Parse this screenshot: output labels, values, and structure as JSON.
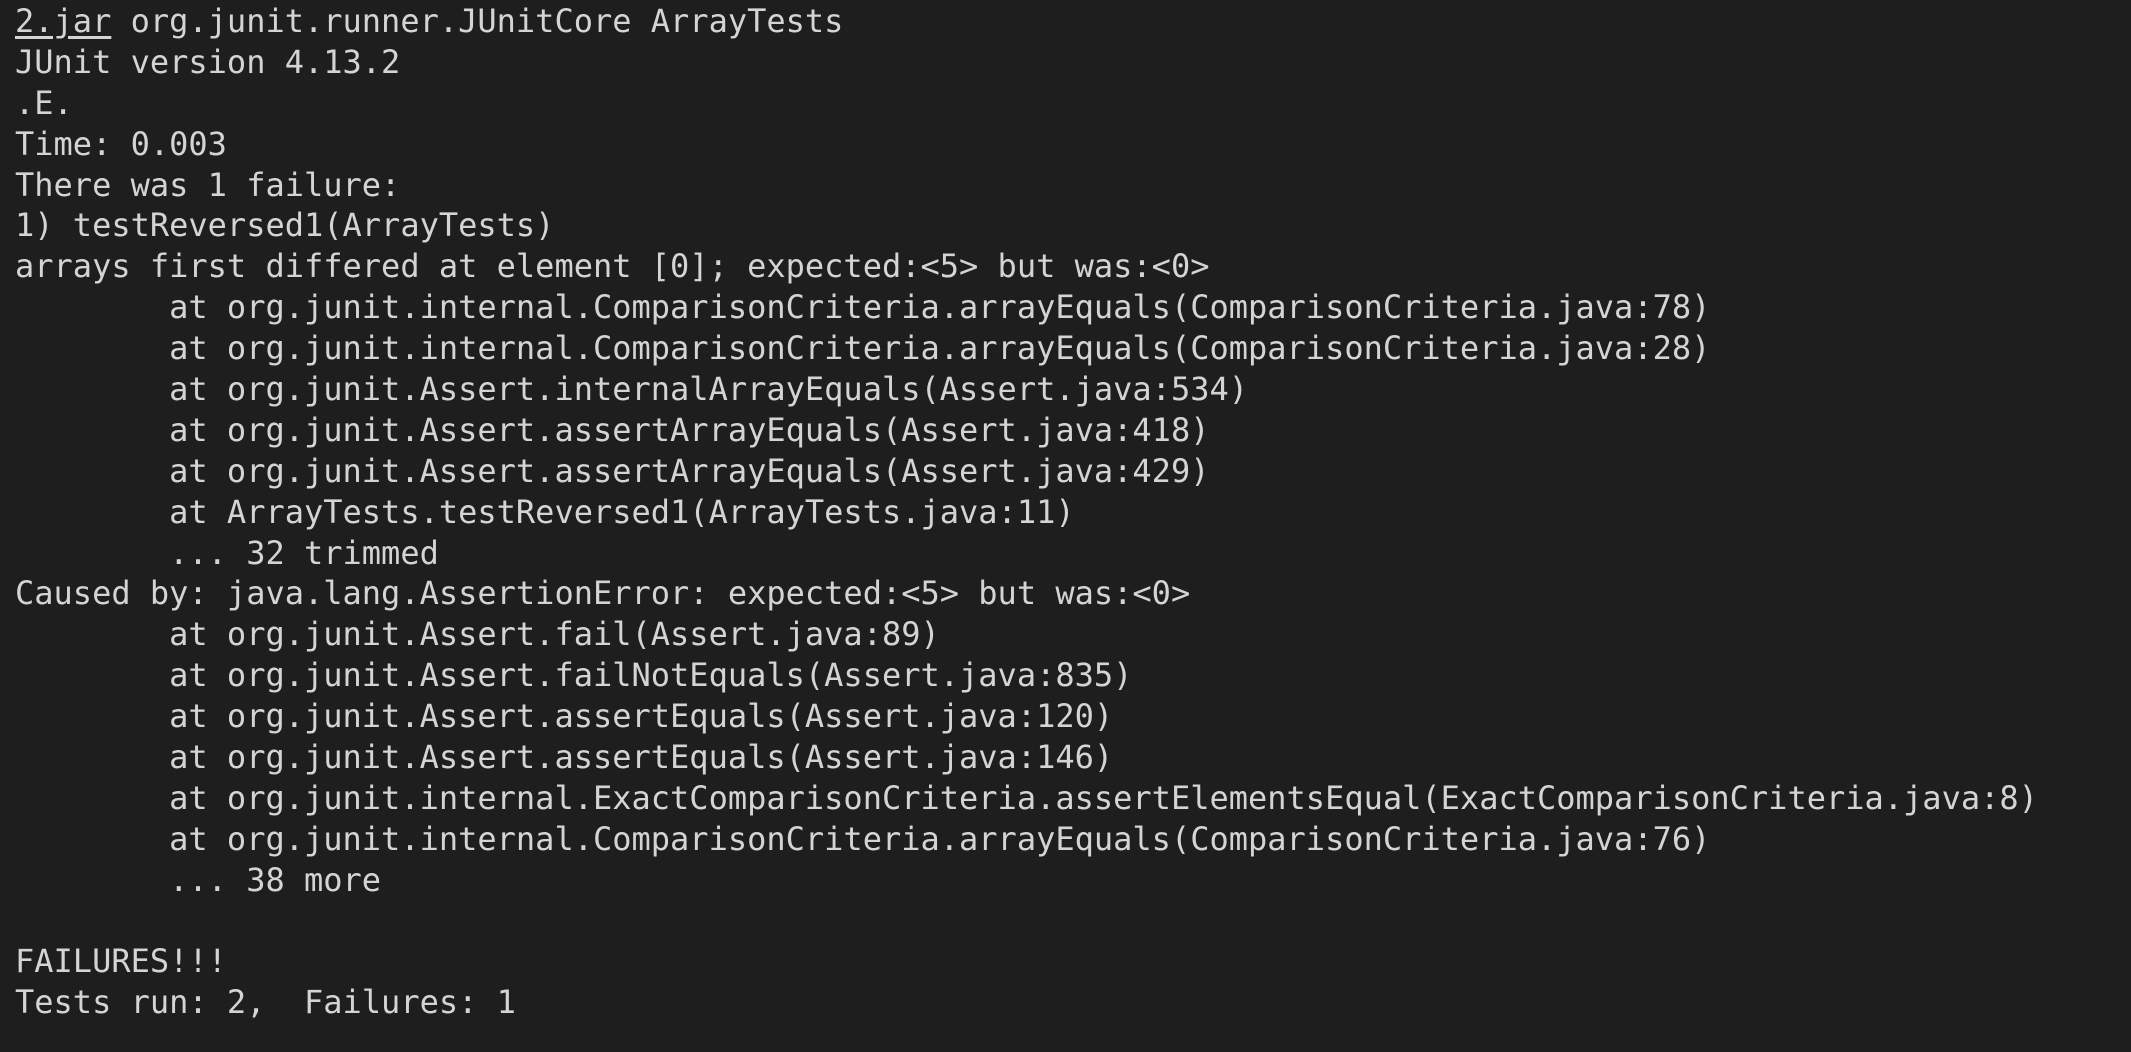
{
  "terminal": {
    "command": {
      "jar_prefix": "2.jar",
      "rest": " org.junit.runner.JUnitCore ArrayTests"
    },
    "lines": [
      "JUnit version 4.13.2",
      ".E.",
      "Time: 0.003",
      "There was 1 failure:",
      "1) testReversed1(ArrayTests)",
      "arrays first differed at element [0]; expected:<5> but was:<0>",
      "        at org.junit.internal.ComparisonCriteria.arrayEquals(ComparisonCriteria.java:78)",
      "        at org.junit.internal.ComparisonCriteria.arrayEquals(ComparisonCriteria.java:28)",
      "        at org.junit.Assert.internalArrayEquals(Assert.java:534)",
      "        at org.junit.Assert.assertArrayEquals(Assert.java:418)",
      "        at org.junit.Assert.assertArrayEquals(Assert.java:429)",
      "        at ArrayTests.testReversed1(ArrayTests.java:11)",
      "        ... 32 trimmed",
      "Caused by: java.lang.AssertionError: expected:<5> but was:<0>",
      "        at org.junit.Assert.fail(Assert.java:89)",
      "        at org.junit.Assert.failNotEquals(Assert.java:835)",
      "        at org.junit.Assert.assertEquals(Assert.java:120)",
      "        at org.junit.Assert.assertEquals(Assert.java:146)",
      "        at org.junit.internal.ExactComparisonCriteria.assertElementsEqual(ExactComparisonCriteria.java:8)",
      "        at org.junit.internal.ComparisonCriteria.arrayEquals(ComparisonCriteria.java:76)",
      "        ... 38 more",
      "",
      "FAILURES!!!",
      "Tests run: 2,  Failures: 1"
    ]
  }
}
